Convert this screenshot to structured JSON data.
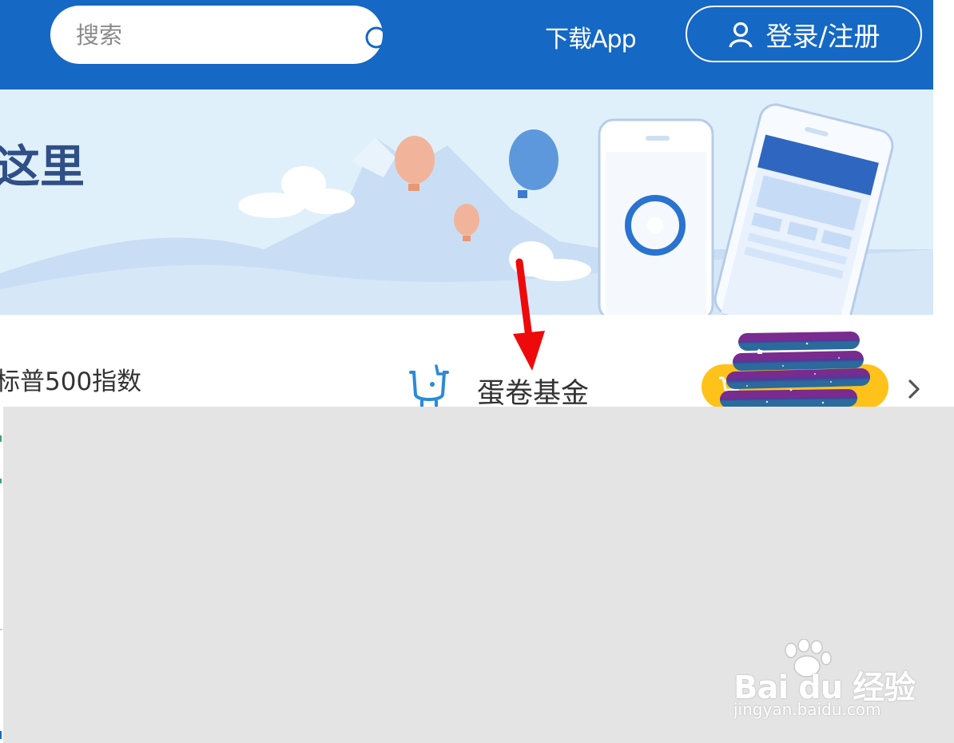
{
  "header": {
    "search_placeholder": "搜索",
    "download_label": "下载App",
    "login_label": "登录/注册",
    "background_color": "#1568c4"
  },
  "banner": {
    "title_fragment": "这里"
  },
  "row": {
    "left_label": "标普500指数",
    "center_label": "蛋卷基金",
    "pill_color": "#ffc21a"
  },
  "watermark": {
    "brand": "Bai du 经验",
    "domain": "jingyan.baidu.com"
  }
}
